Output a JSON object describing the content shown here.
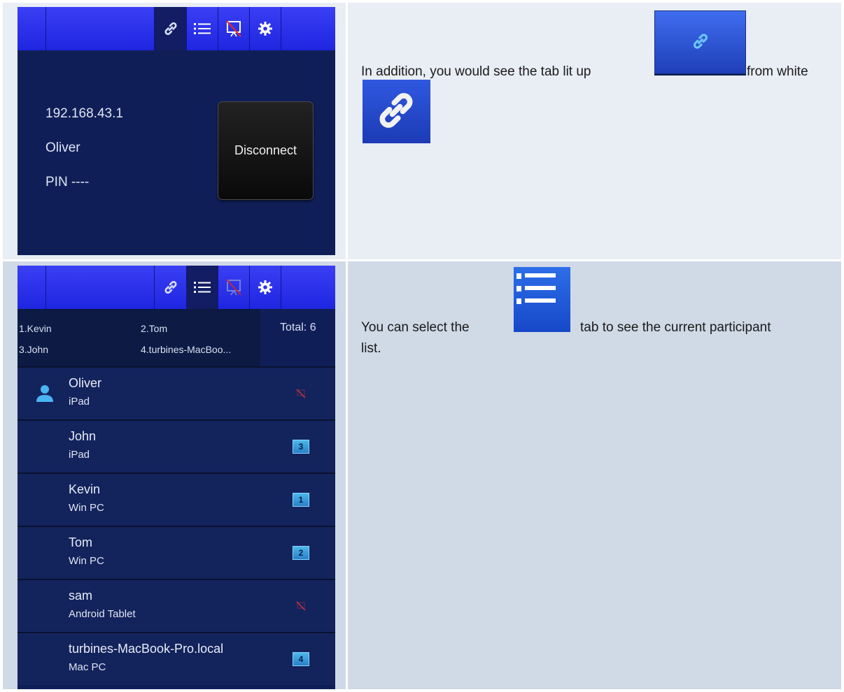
{
  "panel1": {
    "ip": "192.168.43.1",
    "name": "Oliver",
    "pin": "PIN ----",
    "disconnect_label": "Disconnect"
  },
  "text1": {
    "line1_before": "In addition, you would see the tab lit up",
    "line1_after": "from white"
  },
  "text2": {
    "before": "You can select the",
    "after": "tab to see the current participant",
    "line2": "list."
  },
  "panel2": {
    "summary": [
      "1.Kevin",
      "2.Tom",
      "3.John",
      "4.turbines-MacBoo..."
    ],
    "total": "Total: 6",
    "participants": [
      {
        "name": "Oliver",
        "device": "iPad",
        "status": "no-share"
      },
      {
        "name": "John",
        "device": "iPad",
        "status": "screen",
        "screen": "3"
      },
      {
        "name": "Kevin",
        "device": "Win PC",
        "status": "screen",
        "screen": "1"
      },
      {
        "name": "Tom",
        "device": "Win PC",
        "status": "screen",
        "screen": "2"
      },
      {
        "name": "sam",
        "device": "Android Tablet",
        "status": "no-share"
      },
      {
        "name": "turbines-MacBook-Pro.local",
        "device": "Mac PC",
        "status": "screen",
        "screen": "4"
      }
    ]
  },
  "icons": {
    "tabs": [
      "link-icon",
      "list-icon",
      "no-projection-icon",
      "gear-icon"
    ],
    "user": "user-icon"
  },
  "colors": {
    "tab_bar": "#2a30ea",
    "panel_bg": "#101e58",
    "active_tab": "#121d63",
    "screen_badge": "#3a9ee0",
    "no_share": "#c0303a"
  }
}
